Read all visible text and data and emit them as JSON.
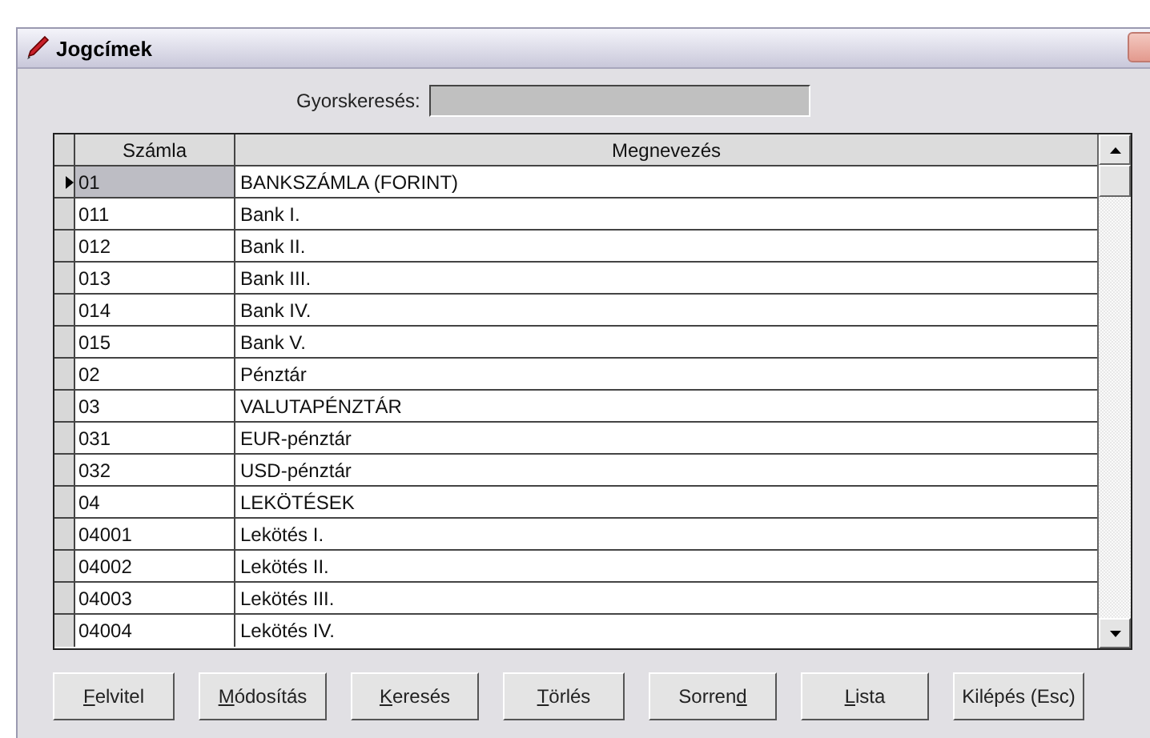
{
  "window": {
    "title": "Jogcímek"
  },
  "search": {
    "label": "Gyorskeresés:"
  },
  "table": {
    "columns": [
      "Számla",
      "Megnevezés"
    ],
    "rows": [
      {
        "szamla": "01",
        "megnevezes": "BANKSZÁMLA (FORINT)",
        "selected": true
      },
      {
        "szamla": "011",
        "megnevezes": "Bank I.",
        "selected": false
      },
      {
        "szamla": "012",
        "megnevezes": "Bank II.",
        "selected": false
      },
      {
        "szamla": "013",
        "megnevezes": "Bank III.",
        "selected": false
      },
      {
        "szamla": "014",
        "megnevezes": "Bank IV.",
        "selected": false
      },
      {
        "szamla": "015",
        "megnevezes": "Bank V.",
        "selected": false
      },
      {
        "szamla": "02",
        "megnevezes": "Pénztár",
        "selected": false
      },
      {
        "szamla": "03",
        "megnevezes": "VALUTAPÉNZTÁR",
        "selected": false
      },
      {
        "szamla": "031",
        "megnevezes": "EUR-pénztár",
        "selected": false
      },
      {
        "szamla": "032",
        "megnevezes": "USD-pénztár",
        "selected": false
      },
      {
        "szamla": "04",
        "megnevezes": "LEKÖTÉSEK",
        "selected": false
      },
      {
        "szamla": "04001",
        "megnevezes": "Lekötés I.",
        "selected": false
      },
      {
        "szamla": "04002",
        "megnevezes": "Lekötés II.",
        "selected": false
      },
      {
        "szamla": "04003",
        "megnevezes": "Lekötés III.",
        "selected": false
      },
      {
        "szamla": "04004",
        "megnevezes": "Lekötés IV.",
        "selected": false
      }
    ]
  },
  "buttons": [
    {
      "label": [
        {
          "text": "F",
          "underlined": true
        },
        {
          "text": "elvitel",
          "underlined": false
        }
      ]
    },
    {
      "label": [
        {
          "text": "M",
          "underlined": true
        },
        {
          "text": "ódosítás",
          "underlined": false
        }
      ]
    },
    {
      "label": [
        {
          "text": "K",
          "underlined": true
        },
        {
          "text": "eresés",
          "underlined": false
        }
      ]
    },
    {
      "label": [
        {
          "text": "T",
          "underlined": true
        },
        {
          "text": "örlés",
          "underlined": false
        }
      ]
    },
    {
      "label": [
        {
          "text": "Sorren",
          "underlined": false
        },
        {
          "text": "d",
          "underlined": true
        }
      ]
    },
    {
      "label": [
        {
          "text": "L",
          "underlined": true
        },
        {
          "text": "ista",
          "underlined": false
        }
      ]
    },
    {
      "label": [
        {
          "text": "Kilépés (Esc)",
          "underlined": false
        }
      ]
    }
  ]
}
